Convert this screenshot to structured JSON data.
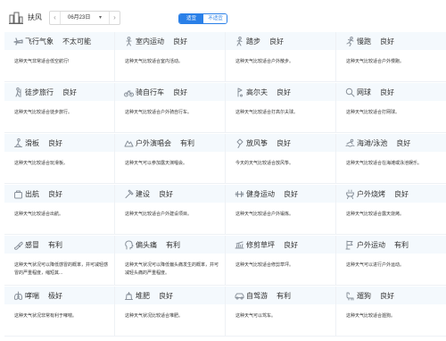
{
  "header": {
    "city": "扶风",
    "date": "06月23日",
    "prev_label": "‹",
    "next_label": "›",
    "caret": "▾",
    "toggle": {
      "on": "适宜",
      "off": "不适宜"
    }
  },
  "colors": {
    "accent": "#2a80e8",
    "icon": "#8a929c",
    "card_top": "#f4f9fd"
  },
  "cards": [
    {
      "icon": "plane-icon",
      "name": "飞行气象",
      "level": "不太可能",
      "desc": "这种天气非常适合低空航行!"
    },
    {
      "icon": "person-icon",
      "name": "室内运动",
      "level": "良好",
      "desc": "这种天气比较适合室内活动。"
    },
    {
      "icon": "walk-icon",
      "name": "踏步",
      "level": "良好",
      "desc": "这种天气比较适合户外散步。"
    },
    {
      "icon": "run-icon",
      "name": "慢跑",
      "level": "良好",
      "desc": "这种天气比较适合户外慢跑。"
    },
    {
      "icon": "hike-icon",
      "name": "徒步旅行",
      "level": "良好",
      "desc": "这种天气比较适合徒步旅行。"
    },
    {
      "icon": "bike-icon",
      "name": "骑自行车",
      "level": "良好",
      "desc": "这种天气比较适合户外骑自行车。"
    },
    {
      "icon": "golf-icon",
      "name": "高尔夫",
      "level": "良好",
      "desc": "这种天气比较适合打高尔夫球。"
    },
    {
      "icon": "tennis-icon",
      "name": "网球",
      "level": "良好",
      "desc": "这种天气比较适合打网球。"
    },
    {
      "icon": "skate-icon",
      "name": "滑板",
      "level": "良好",
      "desc": "这种天气比较适合玩滑板。"
    },
    {
      "icon": "mountain-icon",
      "name": "户外演唱会",
      "level": "有利",
      "desc": "这种天气可以参加露天演唱会。"
    },
    {
      "icon": "kite-icon",
      "name": "放风筝",
      "level": "良好",
      "desc": "今天的天气比较适合放风筝。"
    },
    {
      "icon": "swim-icon",
      "name": "海滩/泳池",
      "level": "良好",
      "desc": "这种天气比较适合在海滩或泳池娱乐。"
    },
    {
      "icon": "bag-icon",
      "name": "出航",
      "level": "良好",
      "desc": "这种天气比较适合出航。"
    },
    {
      "icon": "hammer-icon",
      "name": "建设",
      "level": "良好",
      "desc": "这种天气比较适合户外建设项目。"
    },
    {
      "icon": "fitness-icon",
      "name": "健身运动",
      "level": "良好",
      "desc": "这种天气比较适合户外锻炼。"
    },
    {
      "icon": "bbq-icon",
      "name": "户外烧烤",
      "level": "良好",
      "desc": "这种天气比较适合露天烧烤。"
    },
    {
      "icon": "pill-icon",
      "name": "感冒",
      "level": "有利",
      "desc": "这种天气状况可以降低感冒的概率，并可减轻感冒的严重程度，缩短其..."
    },
    {
      "icon": "head-icon",
      "name": "偏头痛",
      "level": "有利",
      "desc": "这种天气状况可以降低偏头痛发生的概率，并可减轻头痛的严重程度。"
    },
    {
      "icon": "lawn-icon",
      "name": "修剪草坪",
      "level": "良好",
      "desc": "这种天气比较适合修剪草坪。"
    },
    {
      "icon": "sport-icon",
      "name": "户外运动",
      "level": "有利",
      "desc": "这种天气可以进行户外运动。"
    },
    {
      "icon": "lungs-icon",
      "name": "哮喘",
      "level": "极好",
      "desc": "这种天气状况非常有利于哮喘。"
    },
    {
      "icon": "compost-icon",
      "name": "堆肥",
      "level": "良好",
      "desc": "这种天气状况比较适合堆肥。"
    },
    {
      "icon": "car-icon",
      "name": "自驾游",
      "level": "有利",
      "desc": "这种天气可以驾车。"
    },
    {
      "icon": "dog-icon",
      "name": "遛狗",
      "level": "良好",
      "desc": "这种天气比较适合遛狗。"
    }
  ]
}
